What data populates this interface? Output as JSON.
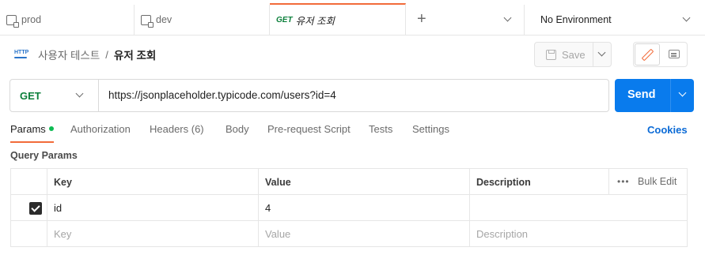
{
  "tabs": [
    {
      "label": "prod"
    },
    {
      "label": "dev"
    },
    {
      "method": "GET",
      "label": "유저 조회"
    }
  ],
  "environment": {
    "label": "No Environment"
  },
  "breadcrumb": {
    "icon_text": "HTTP",
    "parent": "사용자 테스트",
    "separator": "/",
    "current": "유저 조회"
  },
  "toolbar": {
    "save_label": "Save"
  },
  "request": {
    "method": "GET",
    "url": "https://jsonplaceholder.typicode.com/users?id=4",
    "send_label": "Send"
  },
  "request_tabs": [
    {
      "label": "Params"
    },
    {
      "label": "Authorization"
    },
    {
      "label": "Headers (6)"
    },
    {
      "label": "Body"
    },
    {
      "label": "Pre-request Script"
    },
    {
      "label": "Tests"
    },
    {
      "label": "Settings"
    }
  ],
  "cookies_label": "Cookies",
  "query_params": {
    "title": "Query Params",
    "headers": {
      "key": "Key",
      "value": "Value",
      "description": "Description",
      "bulk_edit": "Bulk Edit",
      "more": "•••"
    },
    "rows": [
      {
        "checked": true,
        "key": "id",
        "value": "4",
        "description": ""
      }
    ],
    "placeholder": {
      "key": "Key",
      "value": "Value",
      "description": "Description"
    }
  },
  "colors": {
    "accent": "#f26b3a",
    "send": "#097bed",
    "method_get": "#0b7f3a",
    "cookies": "#0a6ad6"
  }
}
